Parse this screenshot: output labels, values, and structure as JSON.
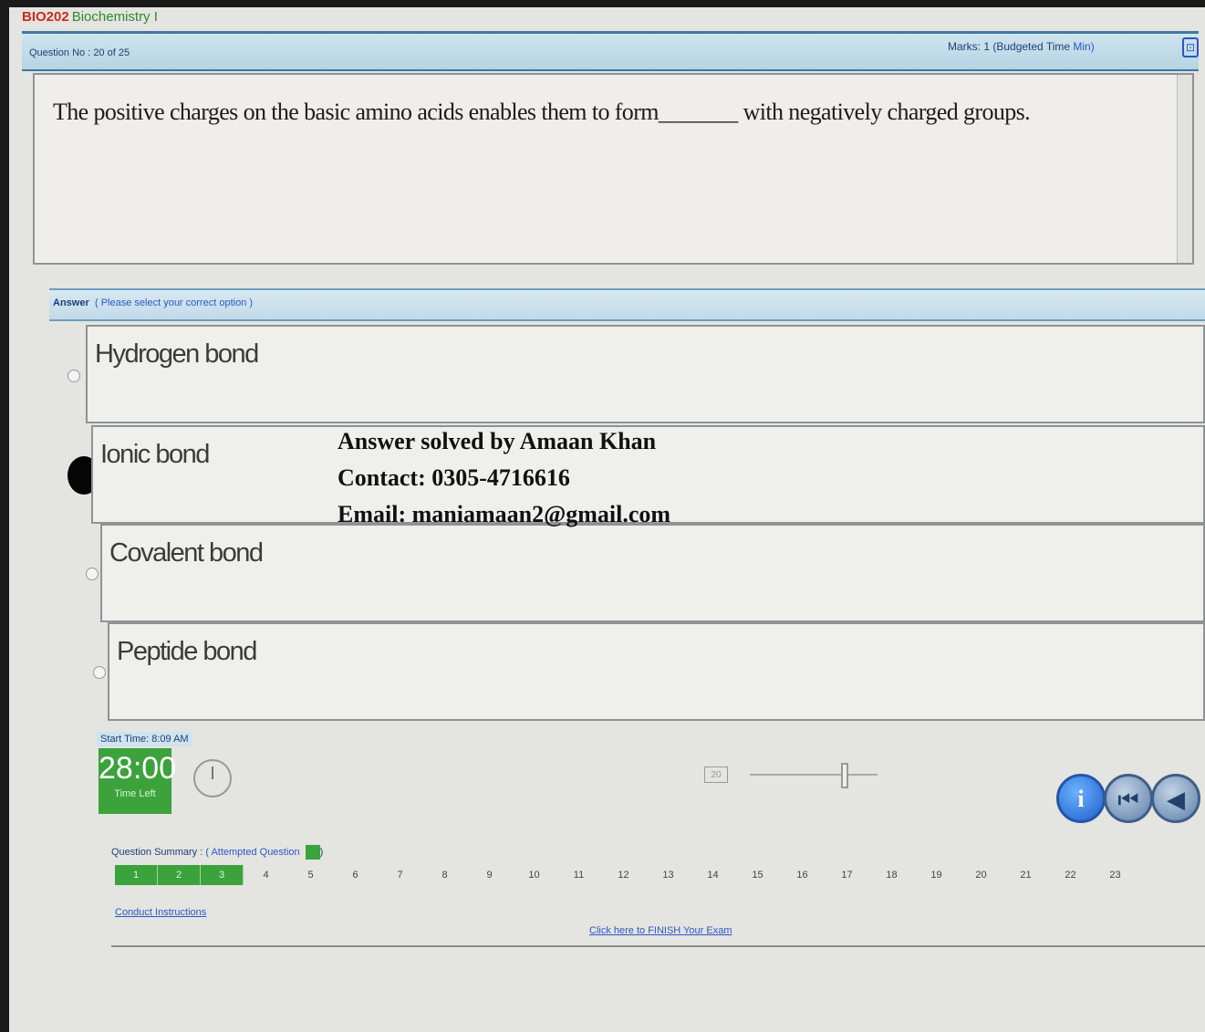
{
  "course": {
    "code": "BIO202",
    "name": "Biochemistry I"
  },
  "question_header": {
    "question_no": "Question No : 20 of 25",
    "marks_prefix": "Marks: 1 (Budgeted Time ",
    "marks_unit": "Min)"
  },
  "question": {
    "text": "The positive charges on the basic amino acids enables them to form_______ with negatively charged groups."
  },
  "answer_header": {
    "label": "Answer",
    "hint": "( Please select your correct option )"
  },
  "options": [
    {
      "label": "Hydrogen bond",
      "selected": false
    },
    {
      "label": "Ionic bond",
      "selected": true
    },
    {
      "label": "Covalent bond",
      "selected": false
    },
    {
      "label": "Peptide bond",
      "selected": false
    }
  ],
  "watermark": {
    "line1": "Answer solved by Amaan Khan",
    "line2": "Contact: 0305-4716616",
    "line3": "Email: maniamaan2@gmail.com"
  },
  "timer": {
    "start_time": "Start Time: 8:09 AM",
    "time_left_value": "28:00",
    "time_left_label": "Time Left"
  },
  "navigation": {
    "current_question": "20",
    "info_icon": "info-icon",
    "first_icon": "skip-first-icon",
    "prev_icon": "previous-icon"
  },
  "summary": {
    "label": "Question Summary : ",
    "attempted_label": "( Attempted Question",
    "close_paren": ")",
    "attempted_color": "#3ca23c",
    "numbers": [
      "1",
      "2",
      "3",
      "4",
      "5",
      "6",
      "7",
      "8",
      "9",
      "10",
      "11",
      "12",
      "13",
      "14",
      "15",
      "16",
      "17",
      "18",
      "19",
      "20",
      "21",
      "22",
      "23"
    ],
    "attempted": [
      1,
      2,
      3
    ]
  },
  "links": {
    "conduct": "Conduct Instructions",
    "finish": "Click here to FINISH Your Exam"
  }
}
